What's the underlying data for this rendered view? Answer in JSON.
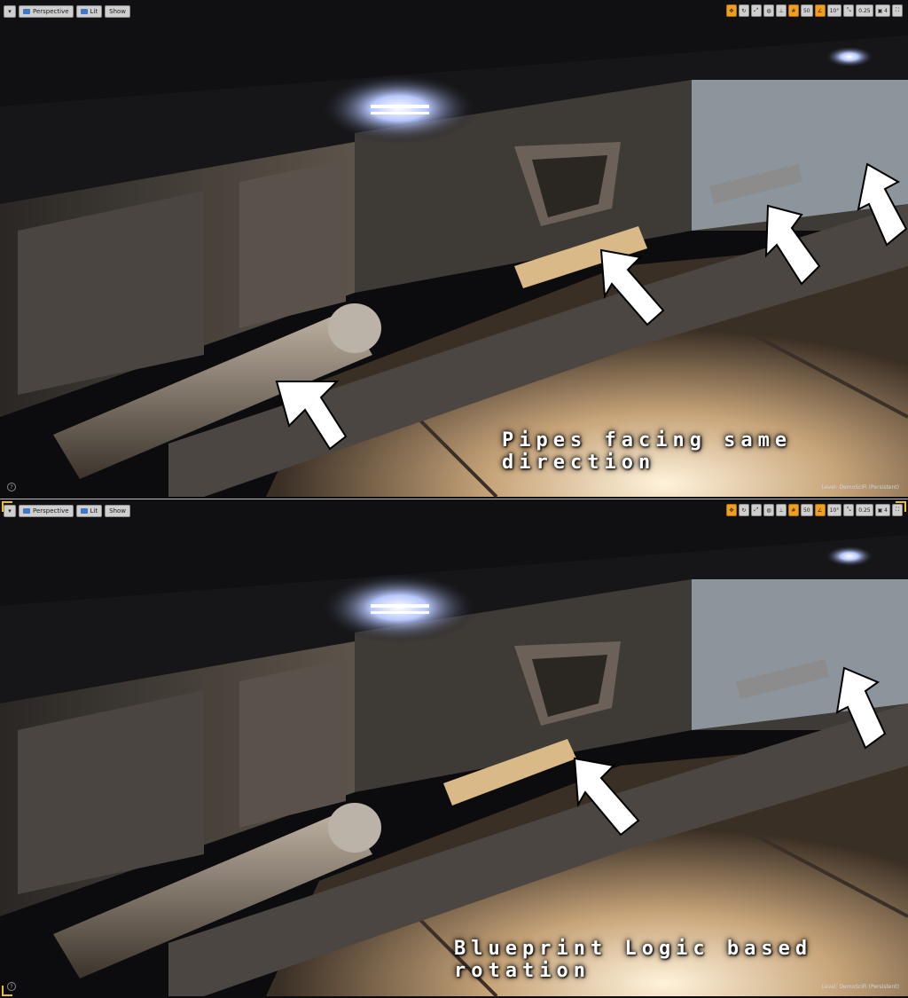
{
  "panels": [
    {
      "toolbar": {
        "perspective_label": "Perspective",
        "lit_label": "Lit",
        "show_label": "Show",
        "grid_value": "50",
        "angle_value": "10°",
        "scale_value": "0.25",
        "camera_speed": "4"
      },
      "caption": "Pipes facing same direction",
      "level_label": "Level:  DemoSciFi (Persistent)",
      "help_icon": "?"
    },
    {
      "toolbar": {
        "perspective_label": "Perspective",
        "lit_label": "Lit",
        "show_label": "Show",
        "grid_value": "50",
        "angle_value": "10°",
        "scale_value": "0.25",
        "camera_speed": "4"
      },
      "caption": "Blueprint Logic based rotation",
      "level_label": "Level:  DemoSciFi (Persistent)",
      "help_icon": "?"
    }
  ],
  "colors": {
    "accent": "#f0a020",
    "selection_corner": "#f0c020",
    "arrow": "#ffffff"
  },
  "icons": [
    "viewport-menu-icon",
    "perspective-icon",
    "lit-icon",
    "snap-icons",
    "camera-speed-icon",
    "maximize-icon",
    "help-icon"
  ]
}
